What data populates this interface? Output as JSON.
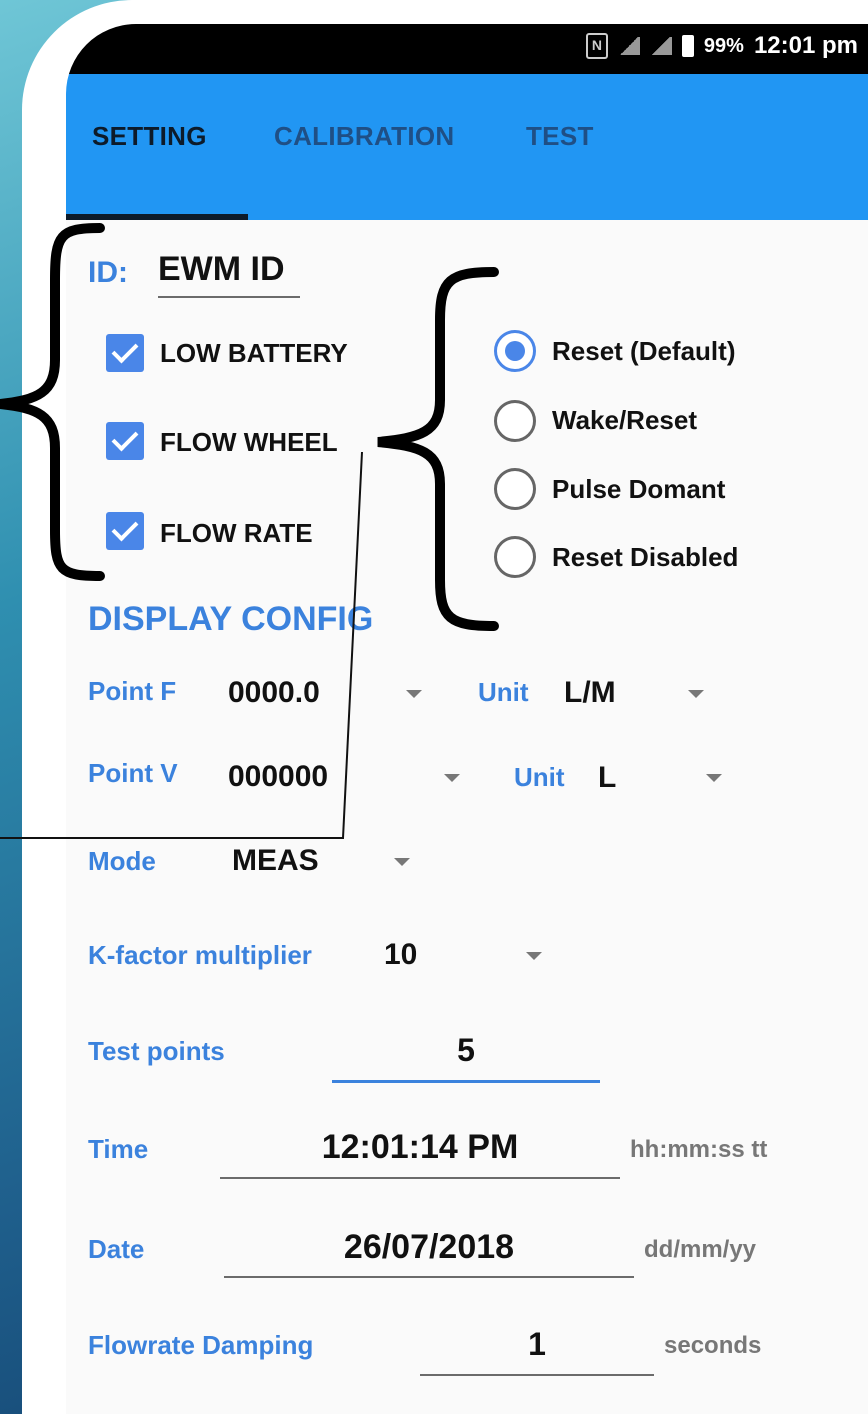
{
  "status_bar": {
    "battery": "99%",
    "time": "12:01 pm"
  },
  "tabs": [
    {
      "label": "SETTING",
      "active": true
    },
    {
      "label": "CALIBRATION",
      "active": false
    },
    {
      "label": "TEST",
      "active": false
    }
  ],
  "id_field": {
    "label": "ID:",
    "value": "EWM ID"
  },
  "checkboxes": [
    {
      "label": "LOW BATTERY",
      "checked": true
    },
    {
      "label": "FLOW WHEEL",
      "checked": true
    },
    {
      "label": "FLOW RATE",
      "checked": true
    }
  ],
  "radio_options": [
    {
      "label": "Reset (Default)",
      "selected": true
    },
    {
      "label": "Wake/Reset",
      "selected": false
    },
    {
      "label": "Pulse Domant",
      "selected": false
    },
    {
      "label": "Reset Disabled",
      "selected": false
    }
  ],
  "display_config": {
    "heading": "DISPLAY CONFIG",
    "point_f": {
      "label": "Point F",
      "value": "0000.0"
    },
    "unit_f": {
      "label": "Unit",
      "value": "L/M"
    },
    "point_v": {
      "label": "Point V",
      "value": "000000"
    },
    "unit_v": {
      "label": "Unit",
      "value": "L"
    },
    "mode": {
      "label": "Mode",
      "value": "MEAS"
    },
    "kfactor": {
      "label": "K-factor multiplier",
      "value": "10"
    }
  },
  "fields": {
    "test_points": {
      "label": "Test points",
      "value": "5"
    },
    "time": {
      "label": "Time",
      "value": "12:01:14 PM",
      "hint": "hh:mm:ss tt"
    },
    "date": {
      "label": "Date",
      "value": "26/07/2018",
      "hint": "dd/mm/yy"
    },
    "damping": {
      "label": "Flowrate Damping",
      "value": "1",
      "hint": "seconds"
    }
  },
  "colors": {
    "appbar": "#2196f3",
    "accent": "#4a86e8",
    "label_blue": "#3b82dd"
  }
}
